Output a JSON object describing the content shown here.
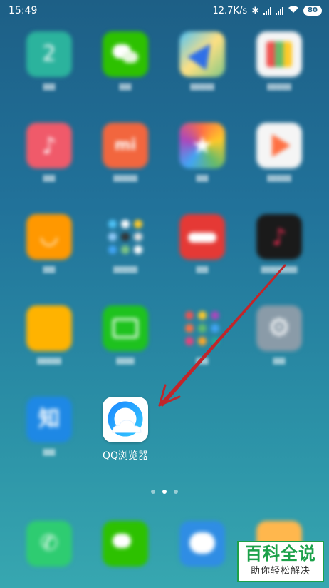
{
  "status_bar": {
    "time": "15:49",
    "net_speed": "12.7K/s",
    "battery": "80",
    "icons": [
      "bluetooth-icon",
      "signal-icon",
      "signal-icon",
      "wifi-icon",
      "battery-icon"
    ]
  },
  "featured_app": {
    "label": "QQ浏览器",
    "icon": "qq-browser-icon"
  },
  "page_indicator": {
    "count": 3,
    "active": 1
  },
  "watermark": {
    "main": "百科全说",
    "sub": "助你轻松解决"
  },
  "colors": {
    "annotation_arrow": "#c0262b",
    "watermark_green": "#1da14a"
  }
}
